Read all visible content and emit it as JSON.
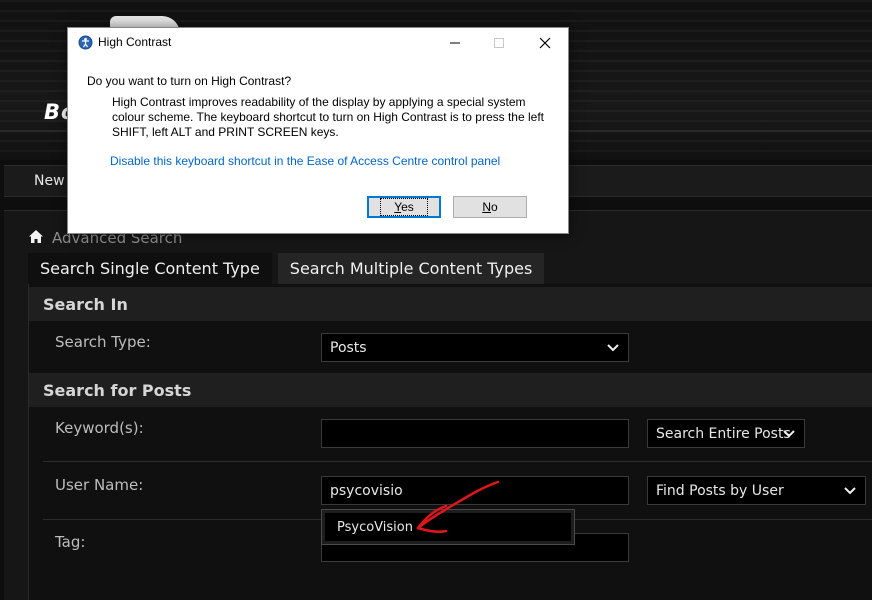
{
  "site": {
    "logo_text": "Bo",
    "nav_new": "New"
  },
  "breadcrumb": {
    "label": "Advanced Search"
  },
  "tabs": [
    {
      "label": "Search Single Content Type",
      "active": false
    },
    {
      "label": "Search Multiple Content Types",
      "active": true
    }
  ],
  "search_in": {
    "heading": "Search In",
    "search_type_label": "Search Type:",
    "search_type_value": "Posts"
  },
  "search_for_posts": {
    "heading": "Search for Posts",
    "keywords_label": "Keyword(s):",
    "keywords_value": "",
    "keywords_scope": "Search Entire Posts",
    "username_label": "User Name:",
    "username_value": "psycovisio",
    "username_mode": "Find Posts by User",
    "tag_label": "Tag:",
    "tag_value": ""
  },
  "autocomplete": {
    "suggestions": [
      "PsycoVision"
    ]
  },
  "dialog": {
    "title": "High Contrast",
    "question": "Do you want to turn on High Contrast?",
    "description": "High Contrast improves readability of the display by applying a special system colour scheme.  The keyboard shortcut to turn on High Contrast is to press the left SHIFT, left ALT and PRINT SCREEN keys.",
    "link": "Disable this keyboard shortcut in the Ease of Access Centre control panel",
    "yes_label": "Yes",
    "no_label": "No"
  },
  "colors": {
    "page_bg": "#0e0e0e",
    "section_head_bg": "#1f1f1f",
    "link": "#0066cc",
    "annotation_red": "#e0161b",
    "dialog_bg": "#ffffff"
  }
}
